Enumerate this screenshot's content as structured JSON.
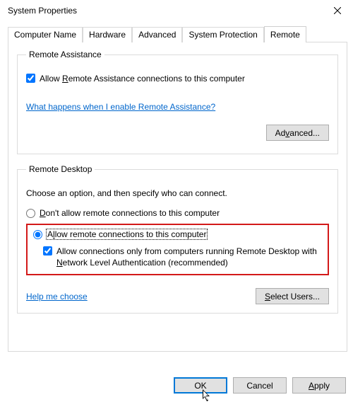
{
  "window": {
    "title": "System Properties"
  },
  "tabs": {
    "computer_name": "Computer Name",
    "hardware": "Hardware",
    "advanced": "Advanced",
    "system_protection": "System Protection",
    "remote": "Remote"
  },
  "remote_assistance": {
    "legend": "Remote Assistance",
    "allow_prefix": "Allow ",
    "allow_accel": "R",
    "allow_suffix": "emote Assistance connections to this computer",
    "link": "What happens when I enable Remote Assistance?",
    "advanced_btn_pre": "Ad",
    "advanced_btn_accel": "v",
    "advanced_btn_post": "anced..."
  },
  "remote_desktop": {
    "legend": "Remote Desktop",
    "intro": "Choose an option, and then specify who can connect.",
    "dont_allow_accel": "D",
    "dont_allow_suffix": "on't allow remote connections to this computer",
    "allow_prefix": "A",
    "allow_accel": "l",
    "allow_suffix": "low remote connections to this computer",
    "nla_prefix": "Allow connections only from computers running Remote Desktop with ",
    "nla_accel": "N",
    "nla_suffix": "etwork Level Authentication (recommended)",
    "help_link": "Help me choose",
    "select_users_accel": "S",
    "select_users_suffix": "elect Users..."
  },
  "buttons": {
    "ok": "OK",
    "cancel": "Cancel",
    "apply_accel": "A",
    "apply_suffix": "pply"
  }
}
